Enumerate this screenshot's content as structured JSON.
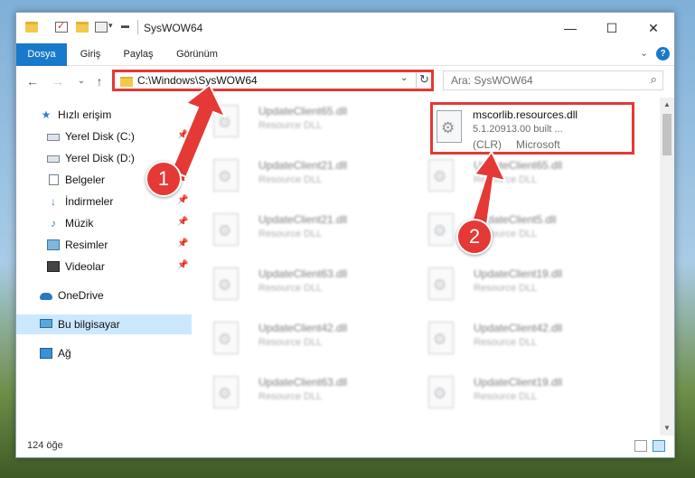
{
  "window": {
    "title": "SysWOW64",
    "minimize_glyph": "—",
    "maximize_glyph": "☐",
    "close_glyph": "✕"
  },
  "ribbon": {
    "tabs": [
      "Dosya",
      "Giriş",
      "Paylaş",
      "Görünüm"
    ],
    "expand_glyph": "⌄",
    "help_glyph": "?"
  },
  "navigation": {
    "back_glyph": "←",
    "forward_glyph": "→",
    "recent_glyph": "⌄",
    "up_glyph": "↑",
    "address": "C:\\Windows\\SysWOW64",
    "address_dropdown_glyph": "⌄",
    "refresh_glyph": "↻",
    "search_placeholder": "Ara: SysWOW64",
    "search_glyph": "⌕"
  },
  "sidebar": {
    "items": [
      {
        "label": "Hızlı erişim",
        "icon": "star-icon"
      },
      {
        "label": "Yerel Disk (C:)",
        "icon": "drive-icon"
      },
      {
        "label": "Yerel Disk (D:)",
        "icon": "drive-icon"
      },
      {
        "label": "Belgeler",
        "icon": "documents-icon"
      },
      {
        "label": "İndirmeler",
        "icon": "download-icon"
      },
      {
        "label": "Müzik",
        "icon": "music-icon"
      },
      {
        "label": "Resimler",
        "icon": "pictures-icon"
      },
      {
        "label": "Videolar",
        "icon": "videos-icon"
      },
      {
        "label": "OneDrive",
        "icon": "onedrive-icon"
      },
      {
        "label": "Bu bilgisayar",
        "icon": "computer-icon"
      },
      {
        "label": "Ağ",
        "icon": "network-icon"
      }
    ],
    "pin_glyph": "📌",
    "selected": "Bu bilgisayar"
  },
  "files": {
    "highlighted": {
      "name": "mscorlib.resources.dll",
      "line1": "5.1.20913.00 built ...",
      "line2_a": "(CLR)",
      "line2_b": "Microsoft"
    },
    "left_column": [
      {
        "name": "UpdateClient65.dll",
        "desc": "Resource DLL"
      },
      {
        "name": "UpdateClient21.dll",
        "desc": "Resource DLL"
      },
      {
        "name": "UpdateClient21.dll",
        "desc": "Resource DLL"
      },
      {
        "name": "UpdateClient63.dll",
        "desc": "Resource DLL"
      },
      {
        "name": "UpdateClient42.dll",
        "desc": "Resource DLL"
      },
      {
        "name": "UpdateClient63.dll",
        "desc": "Resource DLL"
      }
    ],
    "right_column": [
      {
        "name": "UpdateClient65.dll",
        "desc": "Resource DLL"
      },
      {
        "name": "UpdateClient5.dll",
        "desc": "Resource DLL"
      },
      {
        "name": "UpdateClient19.dll",
        "desc": "Resource DLL"
      },
      {
        "name": "UpdateClient42.dll",
        "desc": "Resource DLL"
      },
      {
        "name": "UpdateClient19.dll",
        "desc": "Resource DLL"
      }
    ]
  },
  "scrollbar": {
    "up_glyph": "▲",
    "down_glyph": "▼"
  },
  "status": {
    "count": "124 öğe"
  },
  "annotations": {
    "callout1": "1",
    "callout2": "2",
    "accent": "#e53935"
  }
}
